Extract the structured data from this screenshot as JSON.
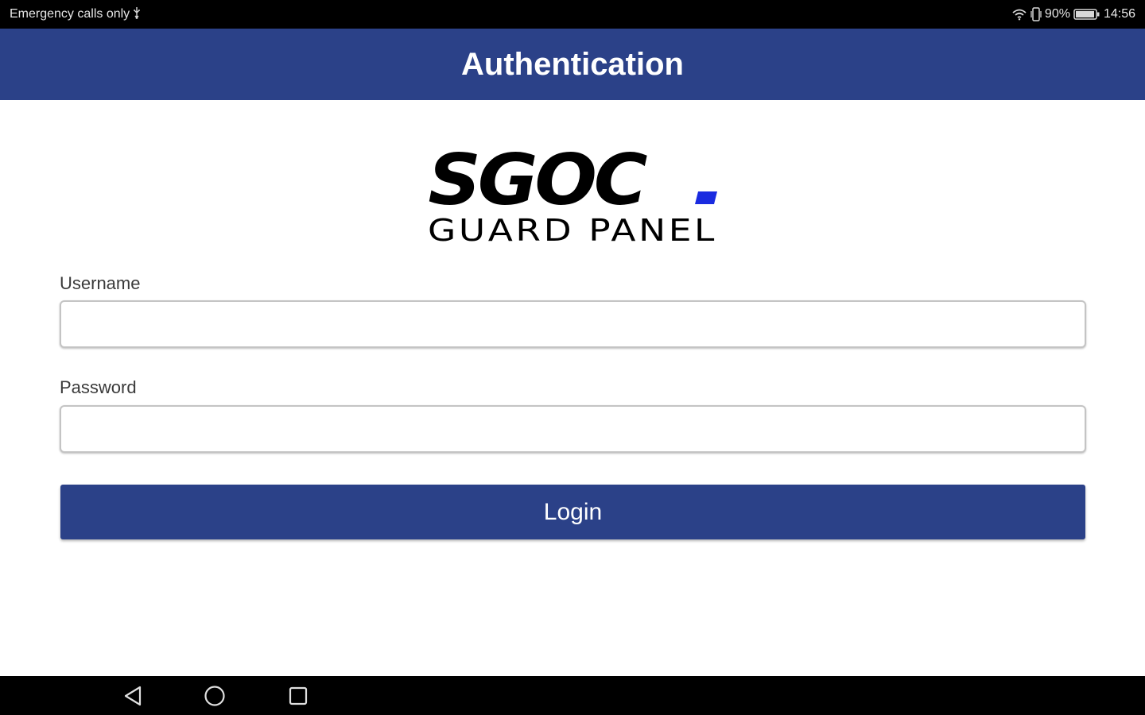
{
  "status_bar": {
    "left_text": "Emergency calls only",
    "usb_icon": "usb-icon",
    "battery_percent": "90%",
    "time": "14:56",
    "icons": [
      "wifi-icon",
      "vibrate-icon",
      "battery-icon"
    ]
  },
  "app_bar": {
    "title": "Authentication",
    "color": "#2b4188"
  },
  "logo": {
    "brand": "SGOC",
    "subtitle": "GUARD PANEL",
    "accent_color": "#1a2be0"
  },
  "form": {
    "username_label": "Username",
    "username_value": "",
    "password_label": "Password",
    "password_value": "",
    "login_label": "Login"
  },
  "nav_bar": {
    "icons": [
      "back-icon",
      "home-icon",
      "recents-icon"
    ]
  }
}
